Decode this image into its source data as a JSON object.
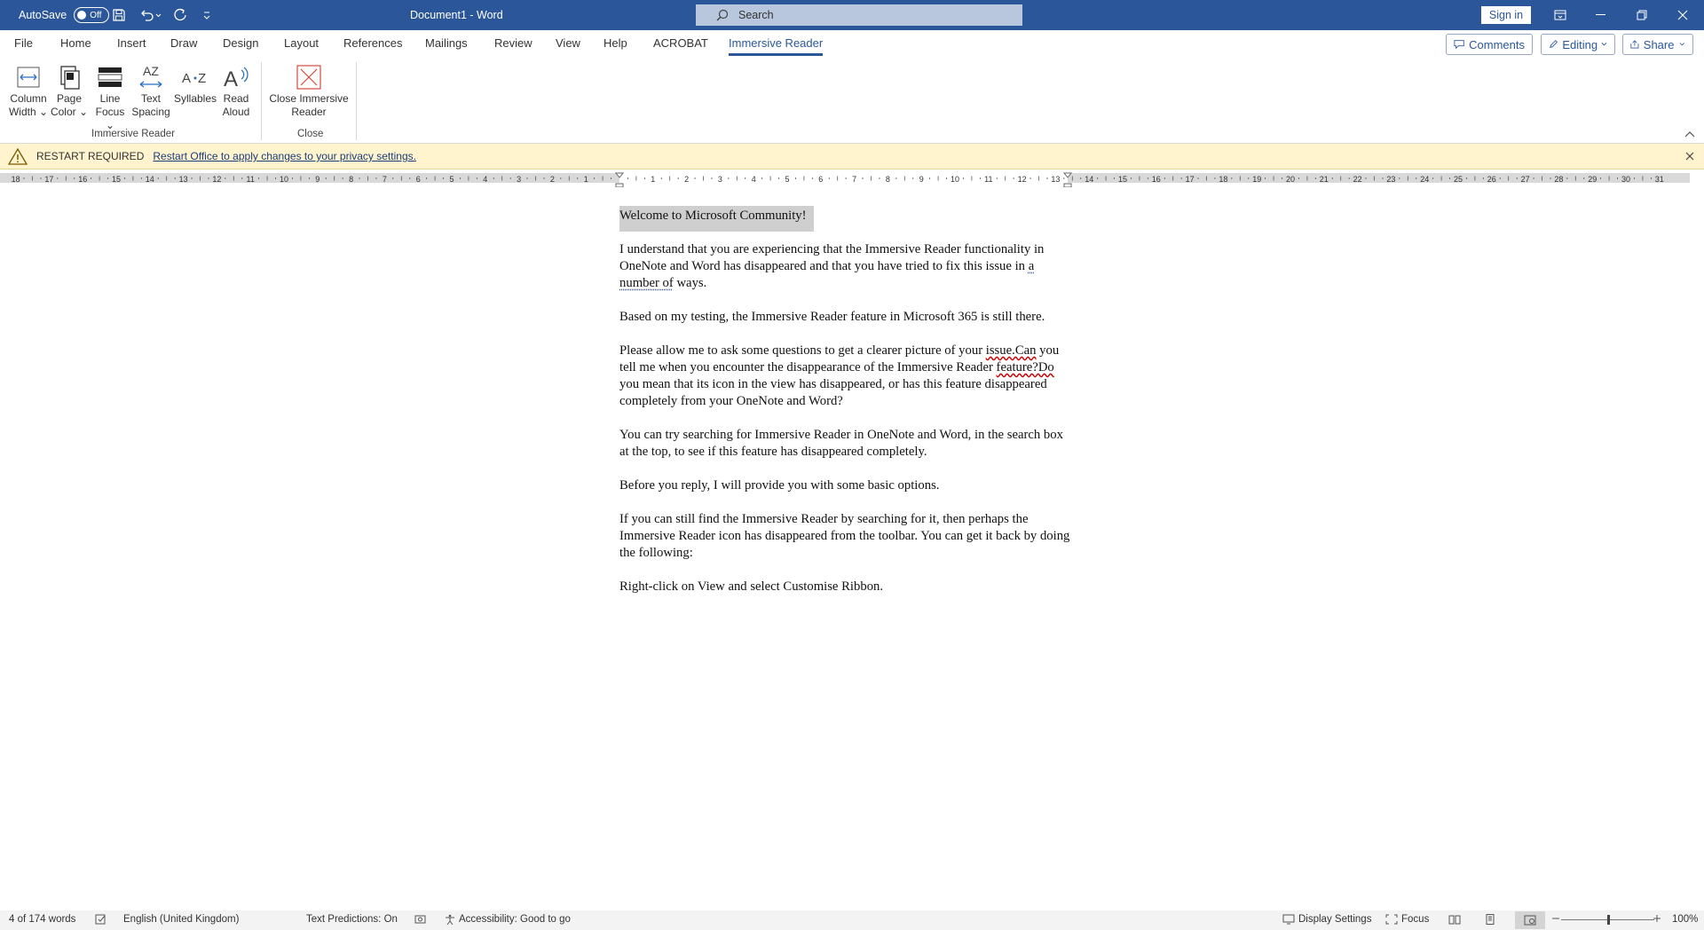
{
  "titlebar": {
    "autosave_label": "AutoSave",
    "autosave_state": "Off",
    "doc_title": "Document1  -  Word",
    "search_placeholder": "Search",
    "signin_label": "Sign in"
  },
  "menu": {
    "tabs": [
      {
        "label": "File"
      },
      {
        "label": "Home"
      },
      {
        "label": "Insert"
      },
      {
        "label": "Draw"
      },
      {
        "label": "Design"
      },
      {
        "label": "Layout"
      },
      {
        "label": "References"
      },
      {
        "label": "Mailings"
      },
      {
        "label": "Review"
      },
      {
        "label": "View"
      },
      {
        "label": "Help"
      },
      {
        "label": "ACROBAT"
      },
      {
        "label": "Immersive Reader"
      }
    ],
    "comments_label": "Comments",
    "editing_label": "Editing",
    "share_label": "Share"
  },
  "ribbon": {
    "buttons": [
      {
        "line1": "Column",
        "line2": "Width"
      },
      {
        "line1": "Page",
        "line2": "Color"
      },
      {
        "line1": "Line",
        "line2": "Focus"
      },
      {
        "line1": "Text",
        "line2": "Spacing"
      },
      {
        "line1": "Syllables",
        "line2": ""
      },
      {
        "line1": "Read",
        "line2": "Aloud"
      },
      {
        "line1": "Close Immersive",
        "line2": "Reader"
      }
    ],
    "group_immersive": "Immersive Reader",
    "group_close": "Close"
  },
  "message_bar": {
    "title": "RESTART REQUIRED",
    "link": "Restart Office to apply changes to your privacy settings."
  },
  "ruler": {
    "left_labels": [
      "18",
      "17",
      "16",
      "15",
      "14",
      "13",
      "12",
      "11",
      "10",
      "9",
      "8",
      "7",
      "6",
      "5",
      "4",
      "3",
      "2",
      "1"
    ],
    "right_labels": [
      "1",
      "2",
      "3",
      "4",
      "5",
      "6",
      "7",
      "8",
      "9",
      "10",
      "11",
      "12",
      "13",
      "14",
      "15",
      "16",
      "17",
      "18",
      "19",
      "20",
      "21",
      "22",
      "23",
      "24",
      "25",
      "26",
      "27",
      "28",
      "29",
      "30",
      "31"
    ]
  },
  "document": {
    "heading": "Welcome to Microsoft Community!",
    "p1_a": "I understand that you are experiencing that the Immersive Reader functionality in OneNote and Word has disappeared and that you have tried to fix this issue in ",
    "p1_b": "a number of",
    "p1_c": " ways.",
    "p2": "Based on my testing, the Immersive Reader feature in Microsoft 365 is still there.",
    "p3_a": "Please allow me to ask some questions to get a clearer picture of your ",
    "p3_b": "issue.Can",
    "p3_c": " you tell me when you encounter the disappearance of the Immersive Reader ",
    "p3_d": "feature?Do",
    "p3_e": " you mean that its icon in the view has disappeared, or has this feature disappeared completely from your OneNote and Word?",
    "p4": "You can try searching for Immersive Reader in OneNote and Word, in the search box at the top, to see if this feature has disappeared completely.",
    "p5": "Before you reply, I will provide you with some basic options.",
    "p6": "If you can still find the Immersive Reader by searching for it, then perhaps the Immersive Reader icon has disappeared from the toolbar. You can get it back by doing the following:",
    "p7": "Right-click on View and select Customise Ribbon."
  },
  "status": {
    "word_count": "4 of 174 words",
    "language": "English (United Kingdom)",
    "text_predictions": "Text Predictions: On",
    "accessibility": "Accessibility: Good to go",
    "display_settings": "Display Settings",
    "focus": "Focus",
    "zoom": "100%",
    "zoom_level": 0.5
  }
}
